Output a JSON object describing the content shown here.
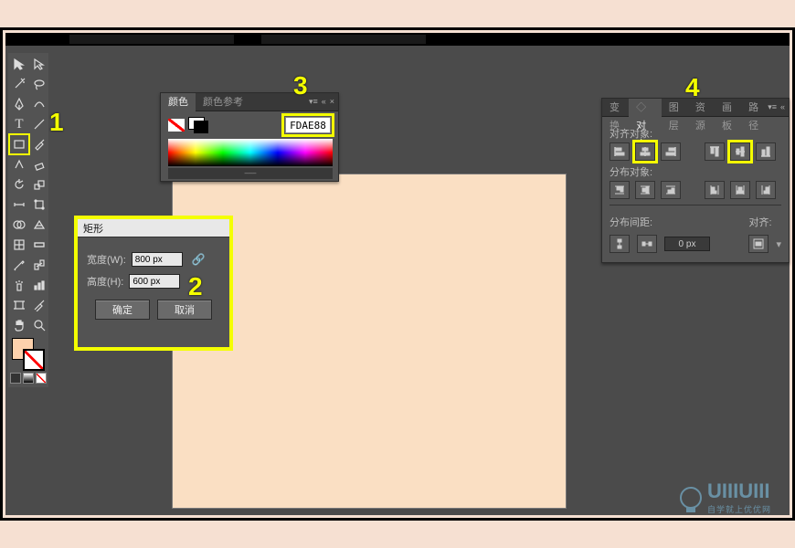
{
  "callouts": {
    "c1": "1",
    "c2": "2",
    "c3": "3",
    "c4": "4"
  },
  "colorPanel": {
    "tab_color": "颜色",
    "tab_colorGuide": "颜色参考",
    "hex": "FDAE88"
  },
  "rectDialog": {
    "title": "矩形",
    "width_label": "宽度(W):",
    "width_value": "800 px",
    "height_label": "高度(H):",
    "height_value": "600 px",
    "ok": "确定",
    "cancel": "取消"
  },
  "alignPanel": {
    "tab_transform": "变换",
    "tab_align": "对齐",
    "tab_layers": "图层",
    "tab_resources": "资源",
    "tab_artboard": "画板",
    "tab_path": "路径",
    "section_alignObjects": "对齐对象:",
    "section_distributeObjects": "分布对象:",
    "section_distributeSpacing": "分布间距:",
    "section_alignTo": "对齐:",
    "spacing_value": "0 px"
  },
  "watermark": {
    "brand": "UIIIUIII",
    "sub": "自学就上优优网"
  }
}
